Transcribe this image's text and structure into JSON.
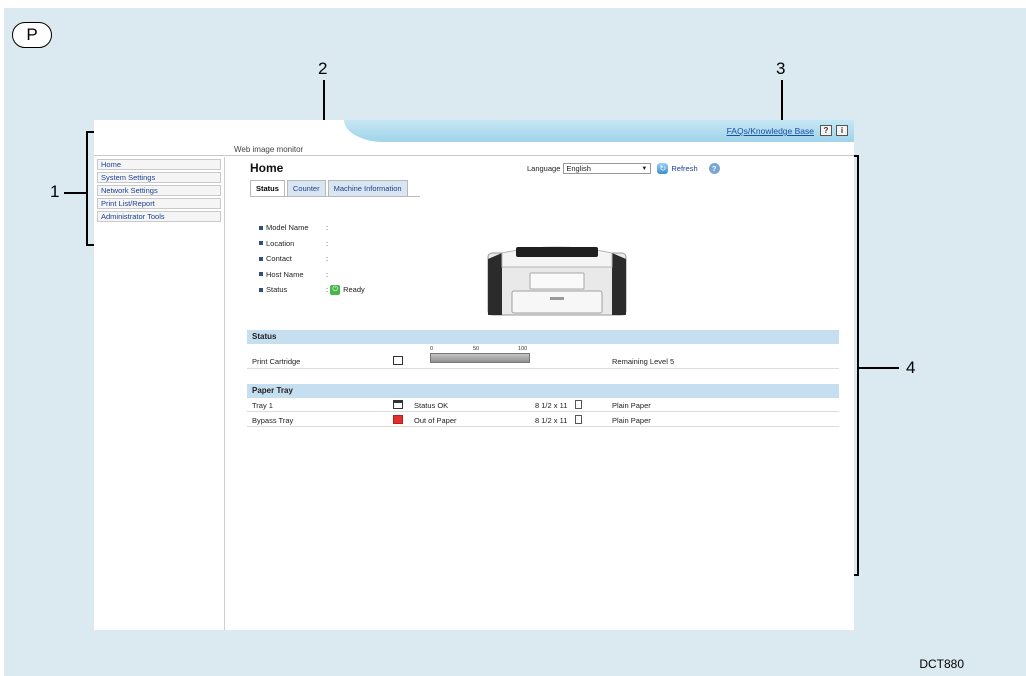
{
  "badge": "P",
  "footer_code": "DCT880",
  "callouts": {
    "c1": "1",
    "c2": "2",
    "c3": "3",
    "c4": "4"
  },
  "header": {
    "faq_link": "FAQs/Knowledge Base",
    "help_btn": "?",
    "info_btn": "i",
    "app_title": "Web image monitor"
  },
  "sidebar": {
    "items": [
      "Home",
      "System Settings",
      "Network Settings",
      "Print List/Report",
      "Administrator Tools"
    ]
  },
  "main": {
    "title": "Home",
    "language_label": "Language",
    "language_value": "English",
    "refresh_label": "Refresh",
    "help_icon": "?",
    "tabs": [
      "Status",
      "Counter",
      "Machine Information"
    ],
    "info": [
      {
        "label": "Model Name",
        "sep": ":",
        "value": ""
      },
      {
        "label": "Location",
        "sep": ":",
        "value": ""
      },
      {
        "label": "Contact",
        "sep": ":",
        "value": ""
      },
      {
        "label": "Host Name",
        "sep": ":",
        "value": ""
      },
      {
        "label": "Status",
        "sep": ":",
        "value": "Ready"
      }
    ]
  },
  "status_section": {
    "heading": "Status",
    "scale": [
      "0",
      "50",
      "100"
    ],
    "cartridge": {
      "label": "Print Cartridge",
      "level_fraction": 1.0,
      "remaining": "Remaining Level 5"
    }
  },
  "paper_section": {
    "heading": "Paper Tray",
    "rows": [
      {
        "name": "Tray 1",
        "state": "Status OK",
        "size": "8 1/2 x 11",
        "type": "Plain Paper"
      },
      {
        "name": "Bypass Tray",
        "state": "Out of Paper",
        "size": "8 1/2 x 11",
        "type": "Plain Paper"
      }
    ]
  },
  "colors": {
    "accent": "#1a3f8e",
    "section": "#c5def0",
    "ok": "#49b649",
    "error": "#e03030",
    "background": "#dbeaf1"
  }
}
